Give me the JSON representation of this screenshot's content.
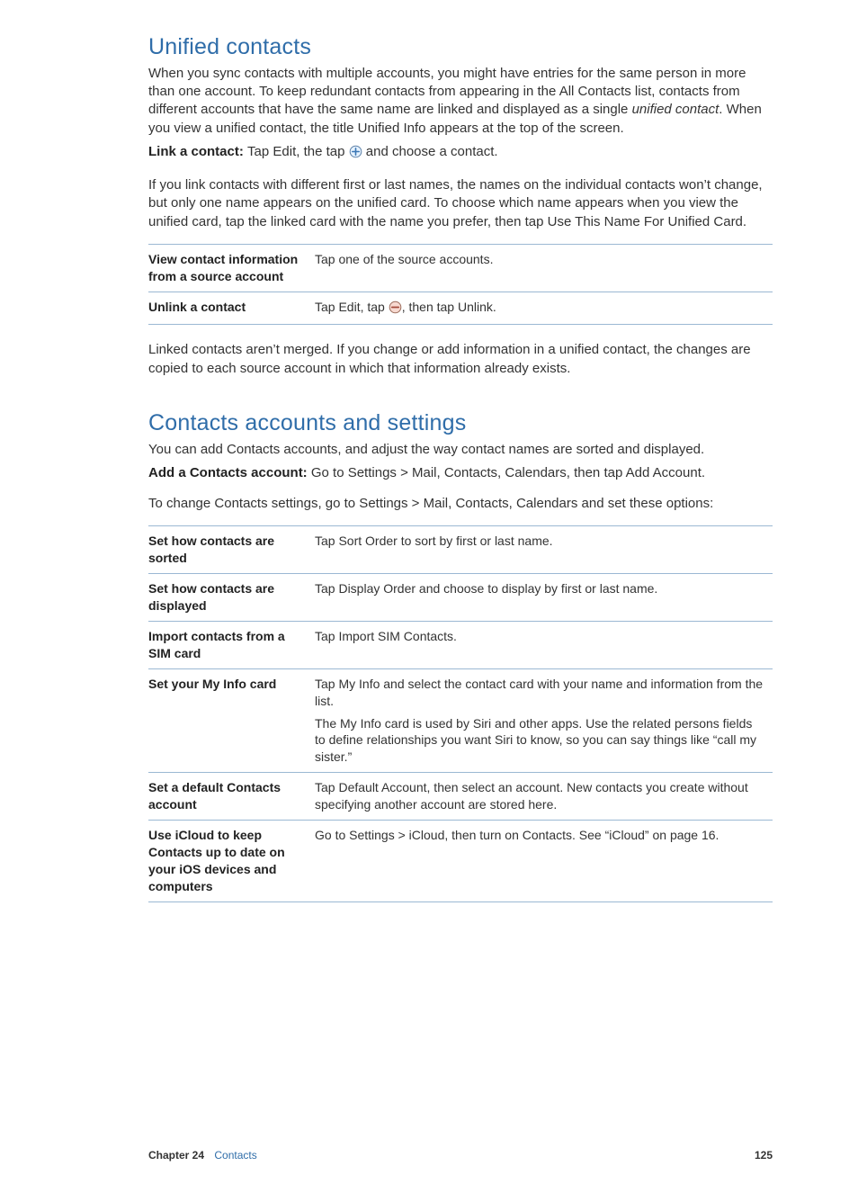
{
  "section1": {
    "heading": "Unified contacts",
    "para1_a": "When you sync contacts with multiple accounts, you might have entries for the same person in more than one account. To keep redundant contacts from appearing in the All Contacts list, contacts from different accounts that have the same name are linked and displayed as a single ",
    "para1_em": "unified contact",
    "para1_b": ". When you view a unified contact, the title Unified Info appears at the top of the screen.",
    "link_label": "Link a contact: ",
    "link_text_a": "Tap Edit, the tap ",
    "link_text_b": " and choose a contact.",
    "para2": "If you link contacts with different first or last names, the names on the individual contacts won’t change, but only one name appears on the unified card. To choose which name appears when you view the unified card, tap the linked card with the name you prefer, then tap Use This Name For Unified Card.",
    "table": [
      {
        "label": "View contact information from a source account",
        "value": "Tap one of the source accounts."
      },
      {
        "label": "Unlink a contact",
        "value_a": "Tap Edit, tap ",
        "value_b": ", then tap Unlink."
      }
    ],
    "para3": "Linked contacts aren’t merged. If you change or add information in a unified contact, the changes are copied to each source account in which that information already exists."
  },
  "section2": {
    "heading": "Contacts accounts and settings",
    "para1": "You can add Contacts accounts, and adjust the way contact names are sorted and displayed.",
    "add_label": "Add a Contacts account:  ",
    "add_text": "Go to Settings > Mail, Contacts, Calendars, then tap Add Account.",
    "para2": "To change Contacts settings, go to Settings > Mail, Contacts, Calendars and set these options:",
    "table": [
      {
        "label": "Set how contacts are sorted",
        "value": "Tap Sort Order to sort by first or last name."
      },
      {
        "label": "Set how contacts are displayed",
        "value": "Tap Display Order and choose to display by first or last name."
      },
      {
        "label": "Import contacts from a SIM card",
        "value": "Tap Import SIM Contacts."
      },
      {
        "label": "Set your My Info card",
        "value": "Tap My Info and select the contact card with your name and information from the list.",
        "value2": "The My Info card is used by Siri and other apps. Use the related persons fields to define relationships you want Siri to know, so you can say things like “call my sister.”"
      },
      {
        "label": "Set a default Contacts account",
        "value": "Tap Default Account, then select an account. New contacts you create without specifying another account are stored here."
      },
      {
        "label": "Use iCloud to keep Contacts up to date on your iOS devices and computers",
        "value": "Go to Settings > iCloud, then turn on Contacts. See “iCloud” on page 16."
      }
    ]
  },
  "footer": {
    "chapter": "Chapter 24",
    "title": "Contacts",
    "page": "125"
  },
  "icons": {
    "add": "add-icon",
    "remove": "remove-icon"
  }
}
